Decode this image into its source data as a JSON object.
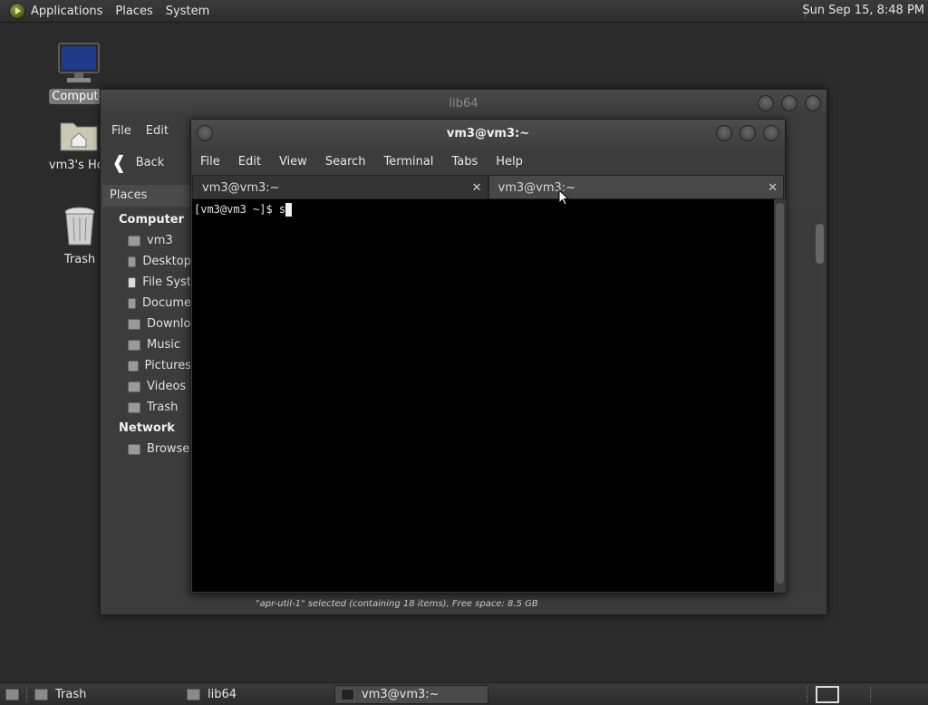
{
  "top_panel": {
    "menus": [
      "Applications",
      "Places",
      "System"
    ],
    "clock": "Sun Sep 15,  8:48 PM"
  },
  "desktop": {
    "icons": [
      {
        "label": "Compute",
        "icon": "computer-icon"
      },
      {
        "label": "vm3's Hor",
        "icon": "home-folder-icon"
      },
      {
        "label": "Trash",
        "icon": "trash-icon"
      }
    ]
  },
  "file_manager": {
    "title": "lib64",
    "menus": [
      "File",
      "Edit"
    ],
    "back_label": "Back",
    "places_label": "Places",
    "sections": [
      {
        "title": "Computer",
        "items": [
          "vm3",
          "Desktop",
          "File Syst",
          "Docume",
          "Downlo",
          "Music",
          "Pictures",
          "Videos",
          "Trash"
        ]
      },
      {
        "title": "Network",
        "items": [
          "Browse"
        ]
      }
    ],
    "status": "\"apr-util-1\" selected (containing 18 items), Free space: 8.5 GB"
  },
  "terminal": {
    "title": "vm3@vm3:~",
    "menus": [
      "File",
      "Edit",
      "View",
      "Search",
      "Terminal",
      "Tabs",
      "Help"
    ],
    "tabs": [
      {
        "label": "vm3@vm3:~",
        "active": false
      },
      {
        "label": "vm3@vm3:~",
        "active": true
      }
    ],
    "prompt": "[vm3@vm3 ~]$ s"
  },
  "taskbar": {
    "tasks": [
      {
        "label": "Trash",
        "active": false
      },
      {
        "label": "lib64",
        "active": false
      },
      {
        "label": "vm3@vm3:~",
        "active": true
      }
    ]
  }
}
